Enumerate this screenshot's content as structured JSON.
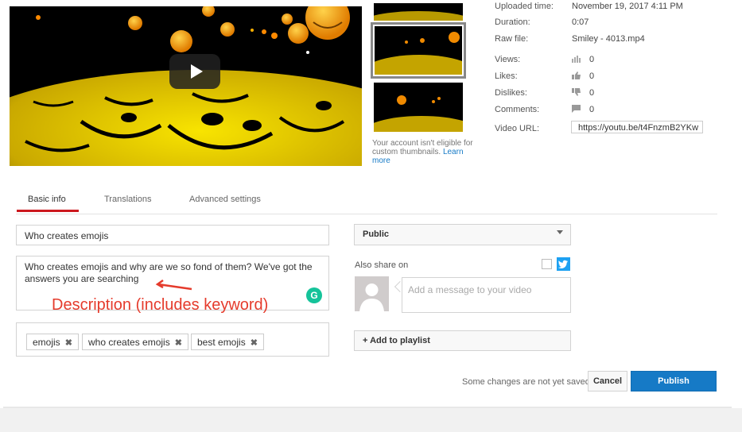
{
  "video": {
    "play_label": ""
  },
  "thumbnails": {
    "note": "Your account isn't eligible for custom thumbnails.",
    "learn_more": "Learn more"
  },
  "details": {
    "uploaded_label": "Uploaded time:",
    "uploaded_value": "November 19, 2017 4:11 PM",
    "duration_label": "Duration:",
    "duration_value": "0:07",
    "raw_label": "Raw file:",
    "raw_value": "Smiley - 4013.mp4",
    "views_label": "Views:",
    "views_value": "0",
    "likes_label": "Likes:",
    "likes_value": "0",
    "dislikes_label": "Dislikes:",
    "dislikes_value": "0",
    "comments_label": "Comments:",
    "comments_value": "0",
    "url_label": "Video URL:",
    "url_value": "https://youtu.be/t4FnzmB2YKw"
  },
  "tabs": [
    "Basic info",
    "Translations",
    "Advanced settings"
  ],
  "form": {
    "title": "Who creates emojis",
    "description": "Who creates emojis and why are we so fond of them? We've got the answers you are searching",
    "tags": [
      "emojis",
      "who creates emojis",
      "best emojis"
    ],
    "annotation": "Description (includes keyword)"
  },
  "privacy": {
    "selected": "Public"
  },
  "share": {
    "label": "Also share on",
    "message_placeholder": "Add a message to your video"
  },
  "playlist": {
    "label": "+ Add to playlist"
  },
  "footer": {
    "unsaved": "Some changes are not yet saved.",
    "cancel": "Cancel",
    "publish": "Publish"
  },
  "colors": {
    "accent_red": "#cc181e",
    "publish_blue": "#167ac6",
    "twitter_blue": "#1da1f2",
    "annotation_red": "#e53b2c",
    "grammarly_green": "#15c39a"
  }
}
